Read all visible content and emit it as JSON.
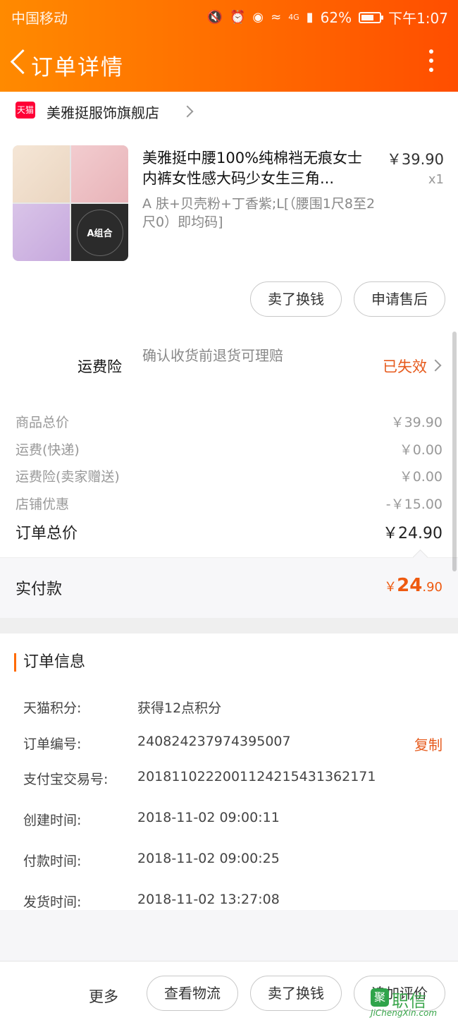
{
  "status_bar": {
    "carrier": "中国移动",
    "battery": "62%",
    "time": "下午1:07",
    "signal": "4G",
    "icons": [
      "mute-icon",
      "alarm-icon",
      "eye-icon",
      "wifi-icon",
      "signal-icon",
      "battery-icon"
    ]
  },
  "nav": {
    "title": "订单详情"
  },
  "shop": {
    "name": "美雅挺服饰旗舰店",
    "badge": "天猫"
  },
  "product": {
    "title": "美雅挺中腰100%纯棉裆无痕女士内裤女性感大码少女生三角...",
    "price": "￥39.90",
    "qty": "x1",
    "sku": "A 肤+贝壳粉+丁香紫;L[（腰围1尺8至2尺0）即均码]",
    "image_badge": "A组合"
  },
  "actions": {
    "sell_exchange": "卖了换钱",
    "after_sales": "申请售后"
  },
  "insurance": {
    "label": "运费险",
    "desc": "确认收货前退货可理赔",
    "status": "已失效"
  },
  "costs": [
    {
      "label": "商品总价",
      "value": "￥39.90"
    },
    {
      "label": "运费(快递)",
      "value": "￥0.00"
    },
    {
      "label": "运费险(卖家赠送)",
      "value": "￥0.00"
    },
    {
      "label": "店铺优惠",
      "value": "-￥15.00"
    }
  ],
  "total": {
    "label": "订单总价",
    "value": "￥24.90"
  },
  "paid": {
    "label": "实付款",
    "currency": "￥",
    "integer": "24",
    "decimal": ".90"
  },
  "info": {
    "title": "订单信息",
    "copy": "复制",
    "rows": [
      {
        "label": "天猫积分:",
        "value": "获得12点积分"
      },
      {
        "label": "订单编号:",
        "value": "240824237974395007"
      },
      {
        "label": "支付宝交易号:",
        "value": "2018110222001124215431362171"
      },
      {
        "label": "创建时间:",
        "value": "2018-11-02 09:00:11"
      },
      {
        "label": "付款时间:",
        "value": "2018-11-02 09:00:25"
      },
      {
        "label": "发货时间:",
        "value": "2018-11-02 13:27:08"
      }
    ]
  },
  "bottom": {
    "more": "更多",
    "logistics": "查看物流",
    "sell_exchange": "卖了换钱",
    "add_review": "追加评价"
  },
  "watermark": {
    "logo": "聚",
    "brand": "职信",
    "url": "JiChengXin.com"
  },
  "colors": {
    "header_start": "#ff8a00",
    "header_end": "#ff4e00",
    "accent": "#e65a1c",
    "tmall": "#ff0036"
  }
}
